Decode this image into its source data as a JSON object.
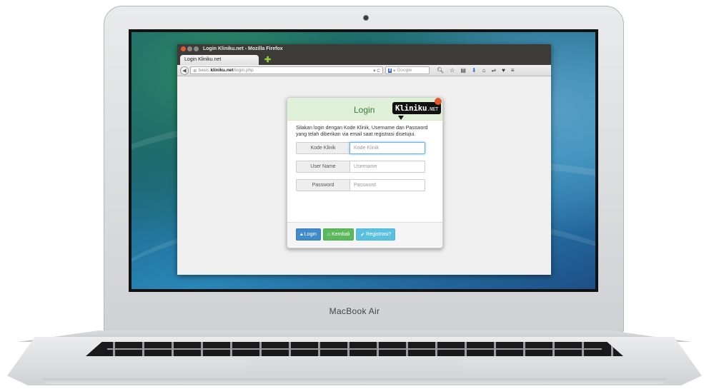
{
  "device": {
    "label": "MacBook Air"
  },
  "window": {
    "title": "Login Kliniku.net - Mozilla Firefox",
    "tab_label": "Login Kliniku.net",
    "new_tab_label": "✚",
    "url_prefix": "basic.",
    "url_domain": "kliniku.net",
    "url_path": "/login.php",
    "search_placeholder": "Google",
    "reload_label": "▾ C"
  },
  "login": {
    "title": "Login",
    "logo_text": "Kliniku",
    "logo_suffix": ".NET",
    "instructions": "Silakan login dengan Kode Klinik, Username dan Password yang telah diberikan via email saat registrasi disetujui.",
    "fields": [
      {
        "label": "Kode Klinik",
        "placeholder": "Kode Klinik"
      },
      {
        "label": "User Name",
        "placeholder": "Username"
      },
      {
        "label": "Password",
        "placeholder": "Password"
      }
    ],
    "buttons": {
      "login": "Login",
      "back": "Kembali",
      "register": "Registrasi?"
    }
  },
  "colors": {
    "header_bg": "#dff0d8",
    "btn_login": "#428bca",
    "btn_back": "#5cb85c",
    "btn_register": "#5bc0de"
  }
}
